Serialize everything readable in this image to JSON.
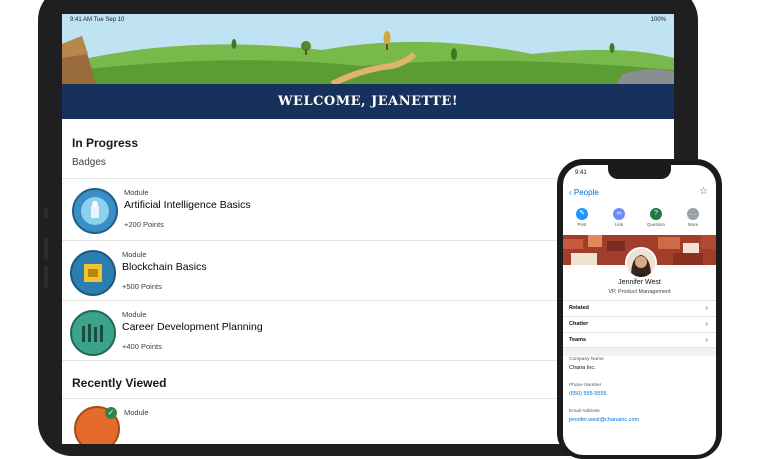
{
  "tablet": {
    "status_time": "9:41 AM   Tue Sep 10",
    "status_battery": "100%",
    "banner_title": "WELCOME, JEANETTE!",
    "in_progress": "In Progress",
    "badges_label": "Badges",
    "modules": [
      {
        "label": "Module",
        "title": "Artificial Intelligence Basics",
        "points": "+200 Points"
      },
      {
        "label": "Module",
        "title": "Blockchain Basics",
        "points": "+500 Points"
      },
      {
        "label": "Module",
        "title": "Career Development Planning",
        "points": "+400 Points"
      }
    ],
    "recently_viewed": "Recently Viewed",
    "recent_module_label": "Module"
  },
  "phone": {
    "time": "9:41",
    "back_label": "People",
    "actions": [
      {
        "label": "Post",
        "icon": "post-icon",
        "color": "#1b96ff"
      },
      {
        "label": "Link",
        "icon": "link-icon",
        "color": "#6c8cf7"
      },
      {
        "label": "Question",
        "icon": "question-icon",
        "color": "#1f7a3d"
      },
      {
        "label": "More",
        "icon": "more-icon",
        "color": "#9aa0a6"
      }
    ],
    "name": "Jennifer West",
    "role": "VP, Product Management",
    "rows": [
      "Related",
      "Chatter",
      "Teams"
    ],
    "fields": [
      {
        "label": "Company Name",
        "value": "Chana Inc."
      },
      {
        "label": "Phone Number",
        "value": "(650) 555-5555"
      },
      {
        "label": "Email Address",
        "value": "jennifer.west@chanainc.com"
      }
    ]
  },
  "colors": {
    "banner_blue": "#16325c",
    "link_blue": "#0070d2",
    "tablet_frame": "#1f1f22"
  }
}
